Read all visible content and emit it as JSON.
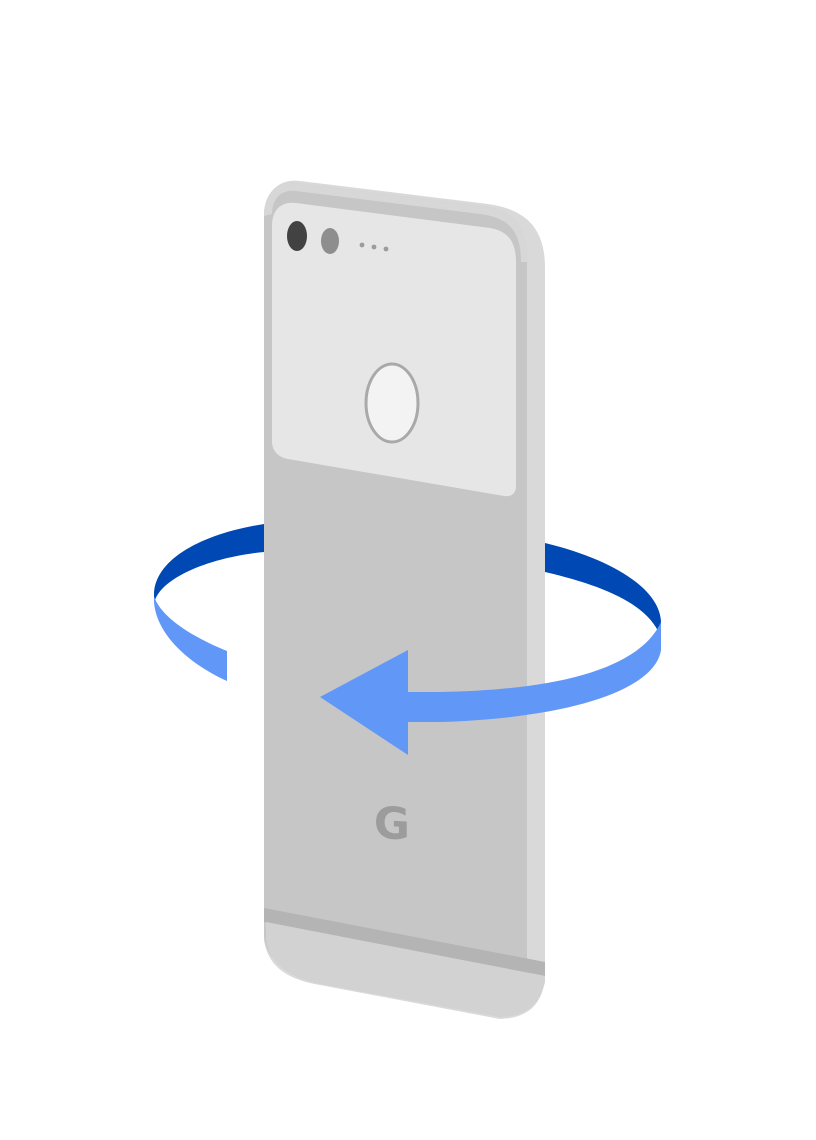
{
  "illustration": {
    "brand_letter": "G",
    "colors": {
      "background": "#ffffff",
      "phone_body": "#c6c6c6",
      "phone_side": "#d9d9d9",
      "phone_edge": "#b4b4b4",
      "glass_panel": "#e6e6e6",
      "camera_lens": "#424242",
      "flash": "#8e8e8e",
      "fingerprint_ring": "#a9a9a9",
      "fingerprint_fill": "#f3f3f3",
      "logo": "#9c9c9c",
      "arrow_dark": "#0048b4",
      "arrow_light": "#6198f7"
    },
    "icons": [
      "phone-back",
      "rotate-arrow-icon",
      "camera-icon",
      "fingerprint-sensor-icon",
      "google-logo"
    ]
  }
}
